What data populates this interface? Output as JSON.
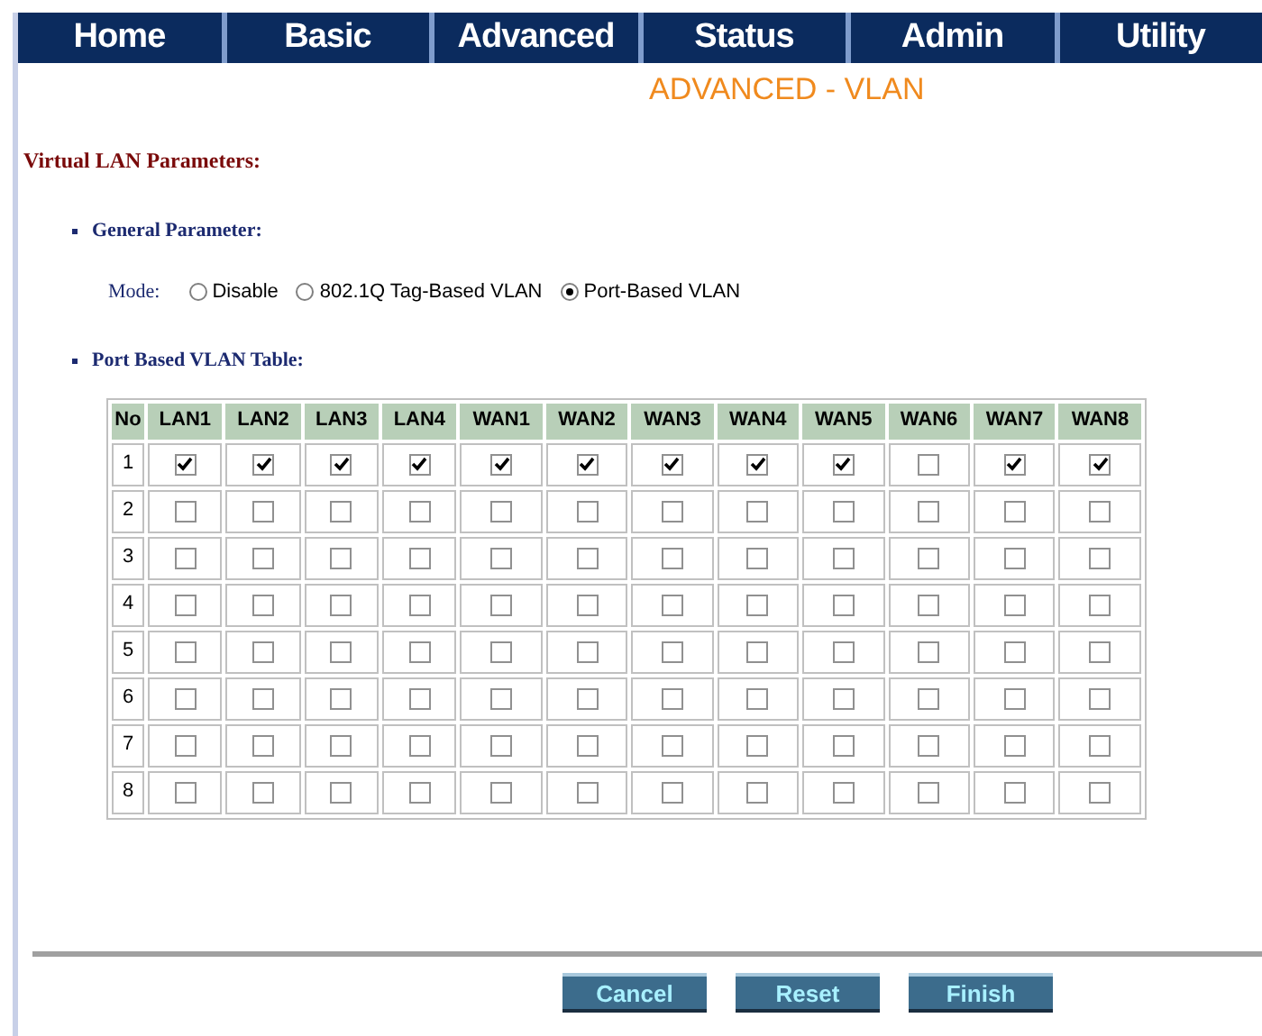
{
  "nav": [
    {
      "label": "Home"
    },
    {
      "label": "Basic"
    },
    {
      "label": "Advanced"
    },
    {
      "label": "Status"
    },
    {
      "label": "Admin"
    },
    {
      "label": "Utility"
    }
  ],
  "page_title": "ADVANCED - VLAN",
  "section_title": "Virtual LAN Parameters:",
  "general": {
    "heading": "General Parameter:",
    "mode_label": "Mode:",
    "options": [
      {
        "label": "Disable",
        "selected": false
      },
      {
        "label": "802.1Q Tag-Based VLAN",
        "selected": false
      },
      {
        "label": "Port-Based VLAN",
        "selected": true
      }
    ]
  },
  "table": {
    "heading": "Port Based VLAN Table:",
    "columns": [
      "No",
      "LAN1",
      "LAN2",
      "LAN3",
      "LAN4",
      "WAN1",
      "WAN2",
      "WAN3",
      "WAN4",
      "WAN5",
      "WAN6",
      "WAN7",
      "WAN8"
    ],
    "rows": [
      {
        "no": "1",
        "cells": [
          true,
          true,
          true,
          true,
          true,
          true,
          true,
          true,
          true,
          false,
          true,
          true
        ]
      },
      {
        "no": "2",
        "cells": [
          false,
          false,
          false,
          false,
          false,
          false,
          false,
          false,
          false,
          false,
          false,
          false
        ]
      },
      {
        "no": "3",
        "cells": [
          false,
          false,
          false,
          false,
          false,
          false,
          false,
          false,
          false,
          false,
          false,
          false
        ]
      },
      {
        "no": "4",
        "cells": [
          false,
          false,
          false,
          false,
          false,
          false,
          false,
          false,
          false,
          false,
          false,
          false
        ]
      },
      {
        "no": "5",
        "cells": [
          false,
          false,
          false,
          false,
          false,
          false,
          false,
          false,
          false,
          false,
          false,
          false
        ]
      },
      {
        "no": "6",
        "cells": [
          false,
          false,
          false,
          false,
          false,
          false,
          false,
          false,
          false,
          false,
          false,
          false
        ]
      },
      {
        "no": "7",
        "cells": [
          false,
          false,
          false,
          false,
          false,
          false,
          false,
          false,
          false,
          false,
          false,
          false
        ]
      },
      {
        "no": "8",
        "cells": [
          false,
          false,
          false,
          false,
          false,
          false,
          false,
          false,
          false,
          false,
          false,
          false
        ]
      }
    ]
  },
  "buttons": [
    {
      "label": "Cancel"
    },
    {
      "label": "Reset"
    },
    {
      "label": "Finish"
    }
  ]
}
